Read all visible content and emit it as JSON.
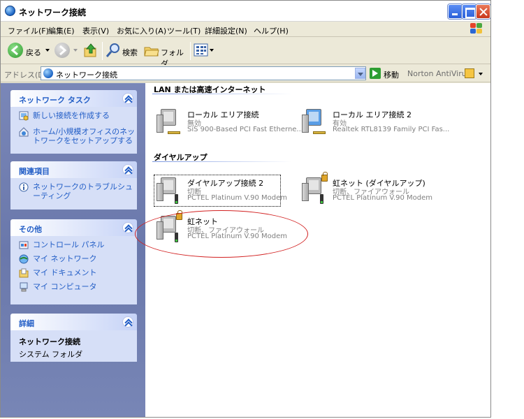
{
  "window": {
    "title": "ネットワーク接続",
    "buttons": [
      "minimize",
      "maximize",
      "close"
    ]
  },
  "menu": {
    "items": [
      "ファイル(F)",
      "編集(E)",
      "表示(V)",
      "お気に入り(A)",
      "ツール(T)",
      "詳細設定(N)",
      "ヘルプ(H)"
    ]
  },
  "toolbar": {
    "back_label": "戻る",
    "search_label": "検索",
    "folders_label": "フォルダ"
  },
  "address": {
    "label": "アドレス(D)",
    "value": "ネットワーク接続",
    "go_label": "移動",
    "norton_label": "Norton AntiVirus"
  },
  "taskpane": {
    "network_tasks": {
      "title": "ネットワーク タスク",
      "links": [
        {
          "icon": "new-connection-icon",
          "label": "新しい接続を作成する"
        },
        {
          "icon": "home-network-icon",
          "label": "ホーム/小規模オフィスのネットワークをセットアップする"
        }
      ]
    },
    "related": {
      "title": "関連項目",
      "links": [
        {
          "icon": "info-icon",
          "label": "ネットワークのトラブルシューティング"
        }
      ]
    },
    "other": {
      "title": "その他",
      "links": [
        {
          "icon": "control-panel-icon",
          "label": "コントロール パネル"
        },
        {
          "icon": "my-network-icon",
          "label": "マイ ネットワーク"
        },
        {
          "icon": "my-documents-icon",
          "label": "マイ ドキュメント"
        },
        {
          "icon": "my-computer-icon",
          "label": "マイ コンピュータ"
        }
      ]
    },
    "details": {
      "title": "詳細",
      "name": "ネットワーク接続",
      "subtitle": "システム フォルダ"
    }
  },
  "groups": {
    "lan": {
      "heading": "LAN または高速インターネット",
      "items": [
        {
          "name": "ローカル エリア接続",
          "status": "無効",
          "device": "SiS 900-Based PCI Fast Etherne..."
        },
        {
          "name": "ローカル エリア接続 2",
          "status": "有効",
          "device": "Realtek RTL8139 Family PCI Fas..."
        }
      ]
    },
    "dialup": {
      "heading": "ダイヤルアップ",
      "items": [
        {
          "name": "ダイヤルアップ接続 2",
          "status": "切断",
          "device": "PCTEL Platinum V.90 Modem",
          "selected": true
        },
        {
          "name": "虹ネット (ダイヤルアップ)",
          "status": "切断、ファイアウォール",
          "device": "PCTEL Platinum V.90 Modem",
          "firewall": true
        },
        {
          "name": "虹ネット",
          "status": "切断、ファイアウォール",
          "device": "PCTEL Platinum V.90 Modem",
          "firewall": true,
          "highlighted": true
        }
      ]
    }
  },
  "colors": {
    "task_link": "#215dc6",
    "annotation": "#d22020",
    "taskpane_bg": "#6a78ab"
  }
}
